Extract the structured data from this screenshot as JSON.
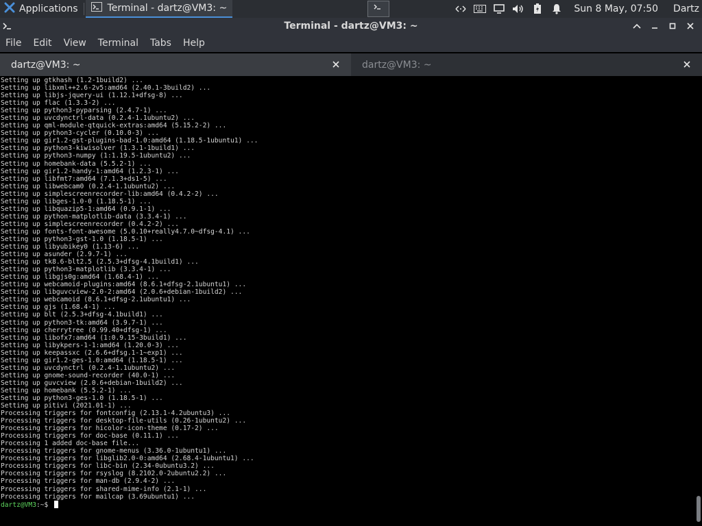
{
  "panel": {
    "apps_label": "Applications",
    "task_label": "Terminal - dartz@VM3: ~",
    "clock": "Sun  8 May, 07:50",
    "user": "Dartz",
    "tray_icons": [
      "network-icon",
      "keyboard-icon",
      "display-icon",
      "volume-icon",
      "battery-icon",
      "notification-bell-icon"
    ]
  },
  "window": {
    "title": "Terminal - dartz@VM3: ~"
  },
  "menu": [
    "File",
    "Edit",
    "View",
    "Terminal",
    "Tabs",
    "Help"
  ],
  "tabs": [
    {
      "label": "dartz@VM3: ~",
      "active": true
    },
    {
      "label": "dartz@VM3: ~",
      "active": false
    }
  ],
  "terminal": {
    "lines": [
      "Setting up gtkhash (1.2-1build2) ...",
      "Setting up libxml++2.6-2v5:amd64 (2.40.1-3build2) ...",
      "Setting up libjs-jquery-ui (1.12.1+dfsg-8) ...",
      "Setting up flac (1.3.3-2) ...",
      "Setting up python3-pyparsing (2.4.7-1) ...",
      "Setting up uvcdynctrl-data (0.2.4-1.1ubuntu2) ...",
      "Setting up qml-module-qtquick-extras:amd64 (5.15.2-2) ...",
      "Setting up python3-cycler (0.10.0-3) ...",
      "Setting up gir1.2-gst-plugins-bad-1.0:amd64 (1.18.5-1ubuntu1) ...",
      "Setting up python3-kiwisolver (1.3.1-1build1) ...",
      "Setting up python3-numpy (1:1.19.5-1ubuntu2) ...",
      "Setting up homebank-data (5.5.2-1) ...",
      "Setting up gir1.2-handy-1:amd64 (1.2.3-1) ...",
      "Setting up libfmt7:amd64 (7.1.3+ds1-5) ...",
      "Setting up libwebcam0 (0.2.4-1.1ubuntu2) ...",
      "Setting up simplescreenrecorder-lib:amd64 (0.4.2-2) ...",
      "Setting up libges-1.0-0 (1.18.5-1) ...",
      "Setting up libquazip5-1:amd64 (0.9.1-1) ...",
      "Setting up python-matplotlib-data (3.3.4-1) ...",
      "Setting up simplescreenrecorder (0.4.2-2) ...",
      "Setting up fonts-font-awesome (5.0.10+really4.7.0~dfsg-4.1) ...",
      "Setting up python3-gst-1.0 (1.18.5-1) ...",
      "Setting up libyubikey0 (1.13-6) ...",
      "Setting up asunder (2.9.7-1) ...",
      "Setting up tk8.6-blt2.5 (2.5.3+dfsg-4.1build1) ...",
      "Setting up python3-matplotlib (3.3.4-1) ...",
      "Setting up libgjs0g:amd64 (1.68.4-1) ...",
      "Setting up webcamoid-plugins:amd64 (8.6.1+dfsg-2.1ubuntu1) ...",
      "Setting up libguvcview-2.0-2:amd64 (2.0.6+debian-1build2) ...",
      "Setting up webcamoid (8.6.1+dfsg-2.1ubuntu1) ...",
      "Setting up gjs (1.68.4-1) ...",
      "Setting up blt (2.5.3+dfsg-4.1build1) ...",
      "Setting up python3-tk:amd64 (3.9.7-1) ...",
      "Setting up cherrytree (0.99.40+dfsg-1) ...",
      "Setting up libofx7:amd64 (1:0.9.15-3build1) ...",
      "Setting up libykpers-1-1:amd64 (1.20.0-3) ...",
      "Setting up keepassxc (2.6.6+dfsg.1-1~exp1) ...",
      "Setting up gir1.2-ges-1.0:amd64 (1.18.5-1) ...",
      "Setting up uvcdynctrl (0.2.4-1.1ubuntu2) ...",
      "Setting up gnome-sound-recorder (40.0-1) ...",
      "Setting up guvcview (2.0.6+debian-1build2) ...",
      "Setting up homebank (5.5.2-1) ...",
      "Setting up python3-ges-1.0 (1.18.5-1) ...",
      "Setting up pitivi (2021.01-1) ...",
      "Processing triggers for fontconfig (2.13.1-4.2ubuntu3) ...",
      "Processing triggers for desktop-file-utils (0.26-1ubuntu2) ...",
      "Processing triggers for hicolor-icon-theme (0.17-2) ...",
      "Processing triggers for doc-base (0.11.1) ...",
      "Processing 1 added doc-base file...",
      "Processing triggers for gnome-menus (3.36.0-1ubuntu1) ...",
      "Processing triggers for libglib2.0-0:amd64 (2.68.4-1ubuntu1) ...",
      "Processing triggers for libc-bin (2.34-0ubuntu3.2) ...",
      "Processing triggers for rsyslog (8.2102.0-2ubuntu2.2) ...",
      "Processing triggers for man-db (2.9.4-2) ...",
      "Processing triggers for shared-mime-info (2.1-1) ...",
      "Processing triggers for mailcap (3.69ubuntu1) ..."
    ],
    "prompt_user": "dartz@VM3",
    "prompt_rest": ":~$ "
  },
  "colors": {
    "prompt_green": "#5fd75f",
    "accent": "#4a90d9"
  }
}
